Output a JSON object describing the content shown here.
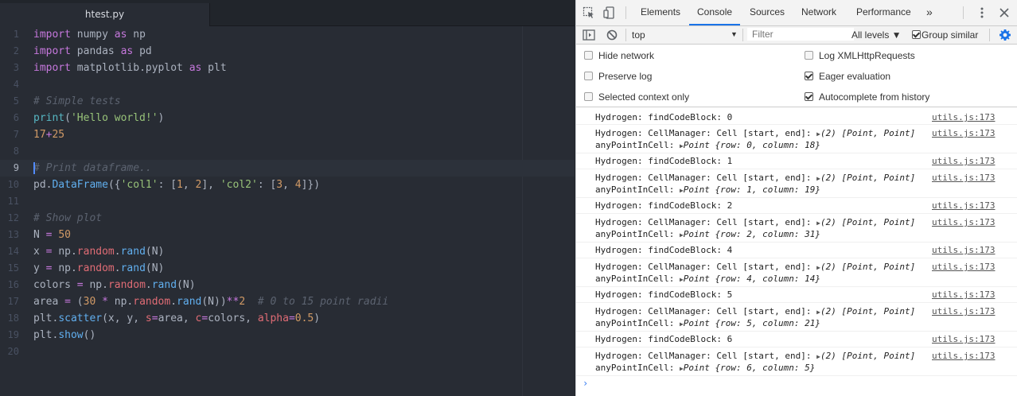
{
  "editor": {
    "tab_title": "htest.py",
    "line_numbers": [
      "1",
      "2",
      "3",
      "4",
      "5",
      "6",
      "7",
      "8",
      "9",
      "10",
      "11",
      "12",
      "13",
      "14",
      "15",
      "16",
      "17",
      "18",
      "19",
      "20"
    ],
    "tokens": {
      "import": "import",
      "as": "as",
      "numpy": "numpy",
      "np": "np",
      "pandas": "pandas",
      "pd": "pd",
      "matplotlib": "matplotlib.pyplot",
      "plt": "plt",
      "comment_simple": "# Simple tests",
      "print": "print",
      "lparen": "(",
      "rparen": ")",
      "hello": "'Hello world!'",
      "n17": "17",
      "plus": "+",
      "n25": "25",
      "comment_print_df": "# Print dataframe..",
      "pd_dot": "pd.",
      "DataFrame": "DataFrame",
      "df_open": "({",
      "col1": "'col1'",
      "colon_open": ": [",
      "n1": "1",
      "comma": ", ",
      "n2": "2",
      "close_comma": "], ",
      "col2": "'col2'",
      "n3": "3",
      "n4": "4",
      "df_close": "]})",
      "comment_show_plot": "# Show plot",
      "N": "N",
      "eq": " = ",
      "n50": "50",
      "x": "x",
      "y": "y",
      "np_dot": "np.",
      "random": "random",
      "dot": ".",
      "rand": "rand",
      "rand_N": "(N)",
      "colors": "colors",
      "area": "area",
      "paren_open": "(",
      "n30": "30",
      "mul": " * ",
      "rand_N_close": "(N))",
      "pow": "**",
      "comment_radii": "# 0 to 15 point radii",
      "plt_dot": "plt.",
      "scatter": "scatter",
      "scatter_args1": "(x, y, ",
      "s": "s",
      "eq_tight": "=",
      "scatter_args2": "area, ",
      "c": "c",
      "scatter_args3": "colors, ",
      "alpha": "alpha",
      "n05": "0.5",
      "show": "show",
      "empty_call": "()"
    }
  },
  "devtools": {
    "tabs": [
      "Elements",
      "Console",
      "Sources",
      "Network",
      "Performance"
    ],
    "active_tab": "Console",
    "more_tabs": "»",
    "toolbar": {
      "context": "top",
      "filter_placeholder": "Filter",
      "levels": "All levels ▼",
      "group_similar": "Group similar"
    },
    "settings": {
      "hide_network": "Hide network",
      "preserve_log": "Preserve log",
      "selected_context_only": "Selected context only",
      "log_xhr": "Log XMLHttpRequests",
      "eager_evaluation": "Eager evaluation",
      "autocomplete_history": "Autocomplete from history"
    },
    "console": {
      "find_prefix": "Hydrogen: findCodeBlock: ",
      "cell_prefix": "Hydrogen: CellManager: Cell [start, end]: ",
      "cell_array": "(2) [Point, Point]",
      "any_prefix": "anyPointInCell: ",
      "point_label": "Point {row: ",
      "column_label": ", column: ",
      "close_brace": "}",
      "source": "utils.js:173",
      "blocks": [
        {
          "find": "0",
          "row": "0",
          "column": "18"
        },
        {
          "find": "1",
          "row": "1",
          "column": "19"
        },
        {
          "find": "2",
          "row": "2",
          "column": "31"
        },
        {
          "find": "4",
          "row": "4",
          "column": "14"
        },
        {
          "find": "5",
          "row": "5",
          "column": "21"
        },
        {
          "find": "6",
          "row": "6",
          "column": "5"
        }
      ],
      "prompt": "›"
    }
  }
}
